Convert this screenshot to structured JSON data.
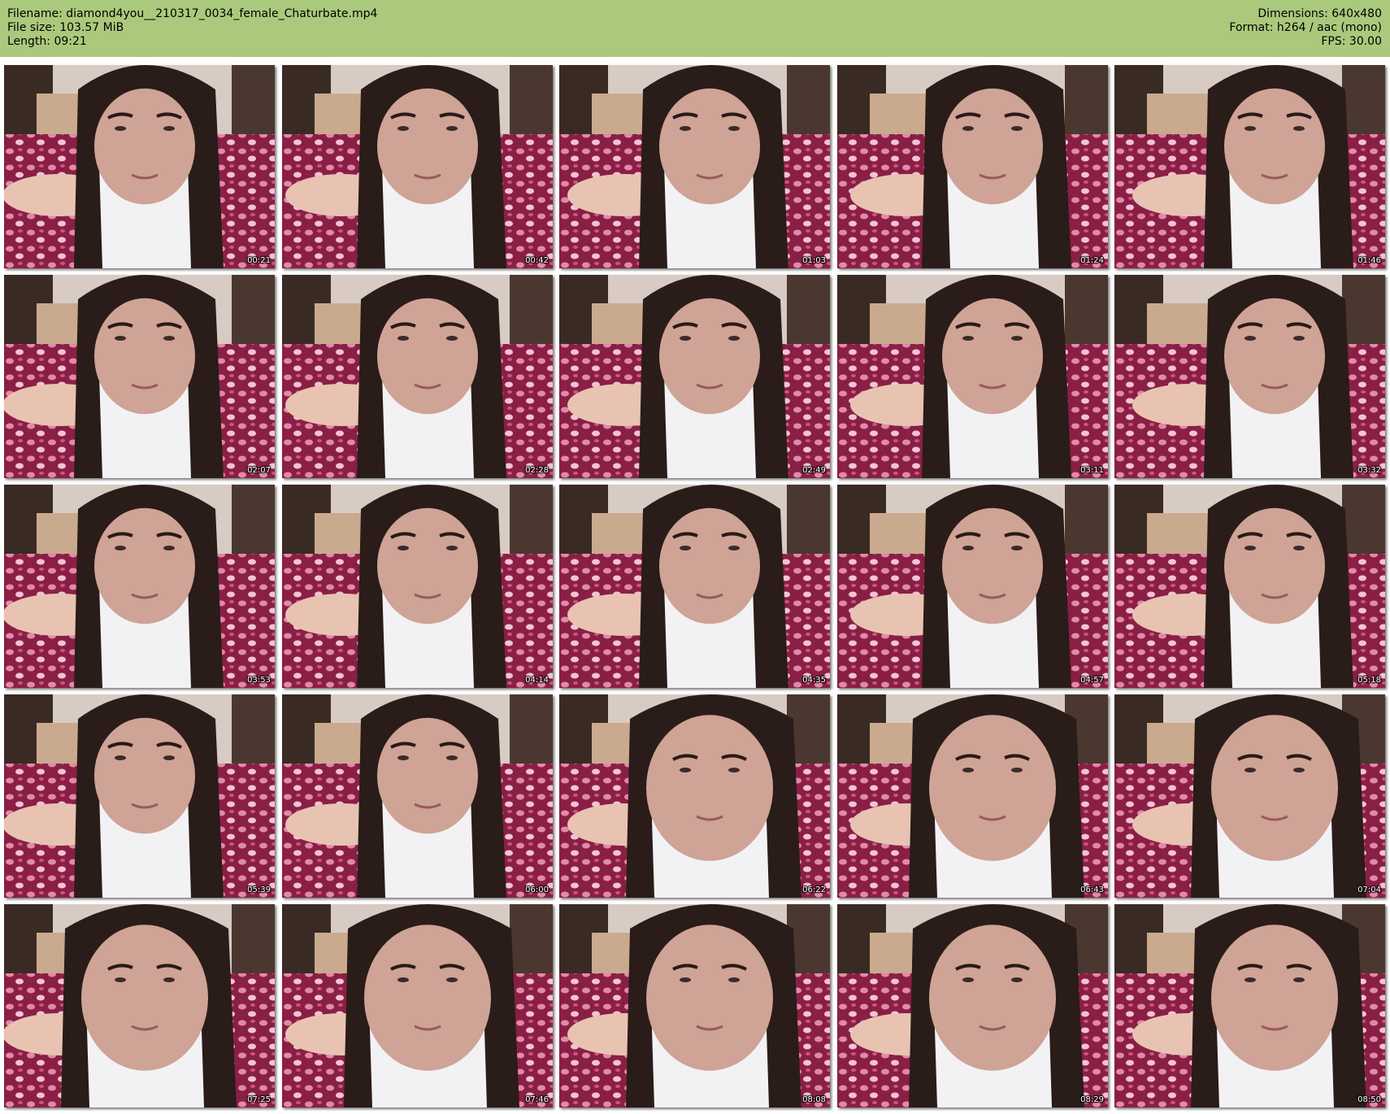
{
  "header": {
    "filename_line": "Filename: diamond4you__210317_0034_female_Chaturbate.mp4",
    "filesize_line": "File size: 103.57 MiB",
    "length_line": "Length: 09:21",
    "dimensions_line": "Dimensions: 640x480",
    "format_line": "Format: h264 / aac (mono)",
    "fps_line": "FPS: 30.00",
    "background_color": "#abc97c"
  },
  "thumbnails": [
    {
      "timestamp": "00:21"
    },
    {
      "timestamp": "00:42"
    },
    {
      "timestamp": "01:03"
    },
    {
      "timestamp": "01:24"
    },
    {
      "timestamp": "01:46"
    },
    {
      "timestamp": "02:07"
    },
    {
      "timestamp": "02:28"
    },
    {
      "timestamp": "02:49"
    },
    {
      "timestamp": "03:11"
    },
    {
      "timestamp": "03:32"
    },
    {
      "timestamp": "03:53"
    },
    {
      "timestamp": "04:14"
    },
    {
      "timestamp": "04:35"
    },
    {
      "timestamp": "04:57"
    },
    {
      "timestamp": "05:18"
    },
    {
      "timestamp": "05:39"
    },
    {
      "timestamp": "06:00"
    },
    {
      "timestamp": "06:22"
    },
    {
      "timestamp": "06:43"
    },
    {
      "timestamp": "07:04"
    },
    {
      "timestamp": "07:25"
    },
    {
      "timestamp": "07:46"
    },
    {
      "timestamp": "08:08"
    },
    {
      "timestamp": "08:29"
    },
    {
      "timestamp": "08:50"
    }
  ]
}
